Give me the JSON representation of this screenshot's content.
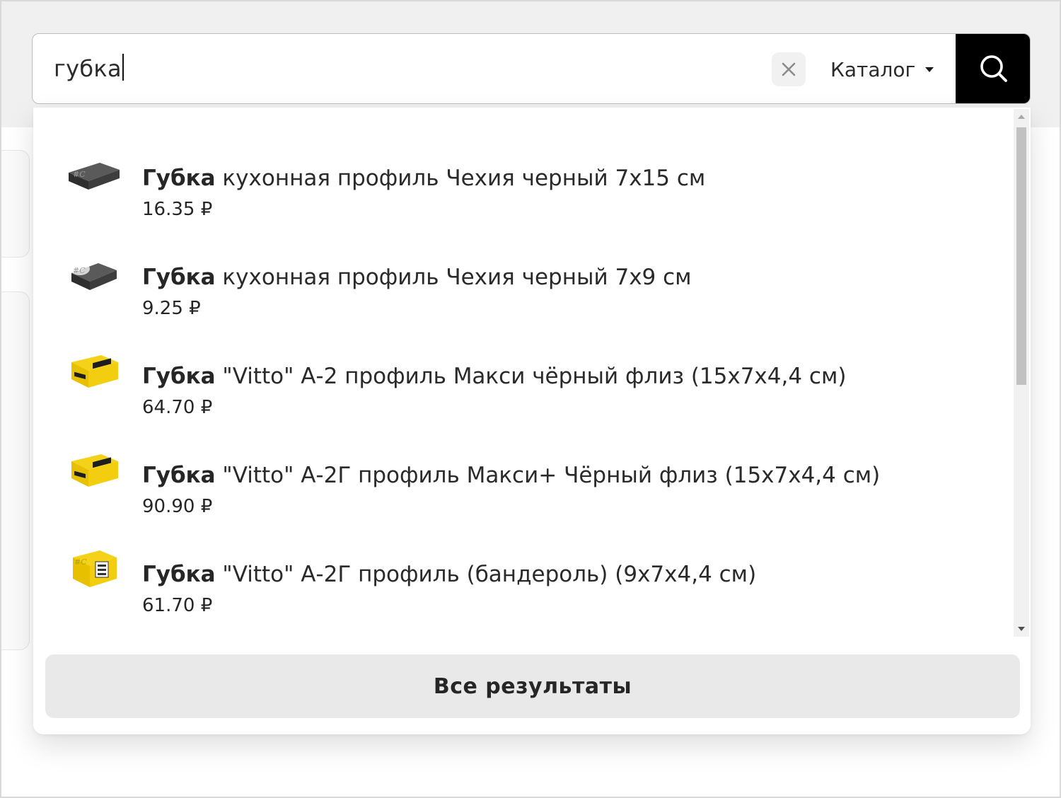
{
  "search": {
    "query": "губка",
    "catalog_label": "Каталог"
  },
  "results": [
    {
      "title_bold": "Губка",
      "title_rest": " кухонная профиль Чехия черный 7х15 см",
      "price": "16.35 ₽",
      "thumb": "dark-sponge"
    },
    {
      "title_bold": "Губка",
      "title_rest": " кухонная профиль Чехия черный 7х9 см",
      "price": "9.25 ₽",
      "thumb": "dark-sponge"
    },
    {
      "title_bold": "Губка",
      "title_rest": " \"Vitto\" А-2 профиль Макси чёрный флиз (15х7х4,4 см)",
      "price": "64.70 ₽",
      "thumb": "yellow-pack"
    },
    {
      "title_bold": "Губка",
      "title_rest": " \"Vitto\" А-2Г профиль Макси+ Чёрный флиз (15х7х4,4 см)",
      "price": "90.90 ₽",
      "thumb": "yellow-pack"
    },
    {
      "title_bold": "Губка",
      "title_rest": " \"Vitto\" А-2Г профиль (бандероль) (9х7х4,4 см)",
      "price": "61.70 ₽",
      "thumb": "yellow-pack"
    }
  ],
  "all_results_label": "Все результаты",
  "colors": {
    "search_button_bg": "#000000",
    "all_results_bg": "#e9e9e9",
    "clear_button_bg": "#f1f1f1"
  }
}
